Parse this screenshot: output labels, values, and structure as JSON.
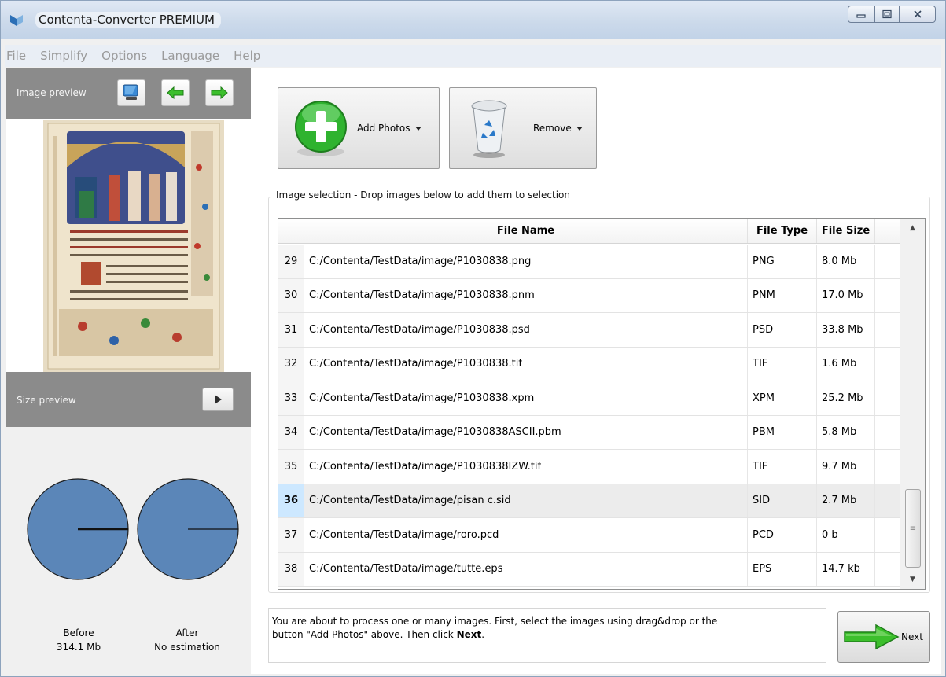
{
  "window": {
    "title": "Contenta-Converter PREMIUM",
    "controls": {
      "minimize": "minimize-icon",
      "maximize": "maximize-icon",
      "close": "close-icon"
    }
  },
  "menubar": {
    "items": [
      "File",
      "Simplify",
      "Options",
      "Language",
      "Help"
    ]
  },
  "left": {
    "image_preview_label": "Image preview",
    "size_preview_label": "Size preview",
    "before": {
      "label": "Before",
      "value": "314.1 Mb"
    },
    "after": {
      "label": "After",
      "value": "No estimation"
    }
  },
  "toolbar": {
    "add_label": "Add Photos",
    "remove_label": "Remove"
  },
  "selection": {
    "group_title": "Image selection - Drop images below to add them to selection",
    "columns": {
      "num": "",
      "name": "File Name",
      "type": "File Type",
      "size": "File Size"
    },
    "selected_row": 36,
    "rows": [
      {
        "num": "29",
        "name": "C:/Contenta/TestData/image/P1030838.png",
        "type": "PNG",
        "size": "8.0 Mb"
      },
      {
        "num": "30",
        "name": "C:/Contenta/TestData/image/P1030838.pnm",
        "type": "PNM",
        "size": "17.0 Mb"
      },
      {
        "num": "31",
        "name": "C:/Contenta/TestData/image/P1030838.psd",
        "type": "PSD",
        "size": "33.8 Mb"
      },
      {
        "num": "32",
        "name": "C:/Contenta/TestData/image/P1030838.tif",
        "type": "TIF",
        "size": "1.6 Mb"
      },
      {
        "num": "33",
        "name": "C:/Contenta/TestData/image/P1030838.xpm",
        "type": "XPM",
        "size": "25.2 Mb"
      },
      {
        "num": "34",
        "name": "C:/Contenta/TestData/image/P1030838ASCII.pbm",
        "type": "PBM",
        "size": "5.8 Mb"
      },
      {
        "num": "35",
        "name": "C:/Contenta/TestData/image/P1030838IZW.tif",
        "type": "TIF",
        "size": "9.7 Mb"
      },
      {
        "num": "36",
        "name": "C:/Contenta/TestData/image/pisan c.sid",
        "type": "SID",
        "size": "2.7 Mb"
      },
      {
        "num": "37",
        "name": "C:/Contenta/TestData/image/roro.pcd",
        "type": "PCD",
        "size": "0 b"
      },
      {
        "num": "38",
        "name": "C:/Contenta/TestData/image/tutte.eps",
        "type": "EPS",
        "size": "14.7 kb"
      }
    ]
  },
  "footer": {
    "info_text_1": "You are about to process one or many images. First, select the images using drag&drop or the",
    "info_text_2": "button \"Add Photos\" above. Then click ",
    "info_text_bold": "Next",
    "info_text_end": ".",
    "next_label": "Next"
  },
  "colors": {
    "pie_fill": "#5b86b8",
    "panel_header": "#8b8b8b",
    "add_green": "#2fb32f",
    "next_green": "#3cbf2c"
  }
}
